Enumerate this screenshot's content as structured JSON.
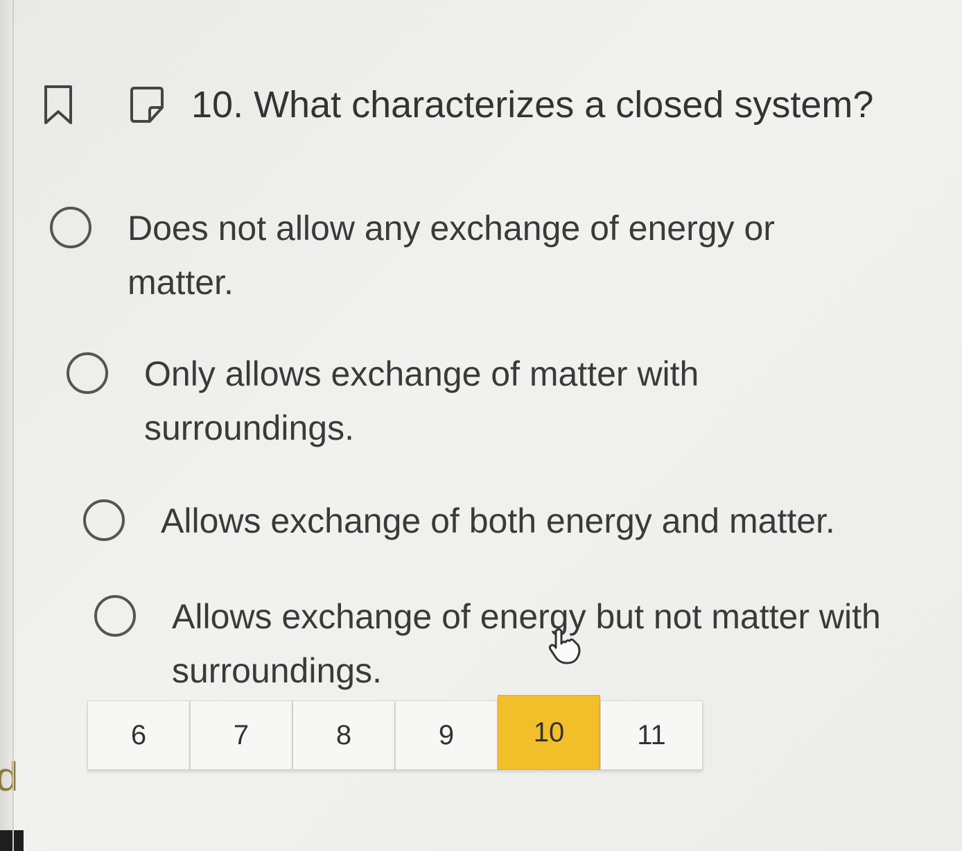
{
  "question": {
    "number": "10.",
    "text": "What characterizes a closed system?"
  },
  "options": [
    {
      "label": "Does not allow any exchange of energy or matter."
    },
    {
      "label": "Only allows exchange of matter with surroundings."
    },
    {
      "label": "Allows exchange of both energy and matter."
    },
    {
      "label": "Allows exchange of energy but not matter with surroundings."
    }
  ],
  "pagination": {
    "pages": [
      "6",
      "7",
      "8",
      "9",
      "10",
      "11"
    ],
    "current": "10"
  },
  "colors": {
    "active_page": "#f2bf2b",
    "text": "#3a3a3a"
  },
  "icons": {
    "bookmark": "bookmark-icon",
    "note": "note-icon",
    "cursor": "hand-cursor-icon"
  }
}
